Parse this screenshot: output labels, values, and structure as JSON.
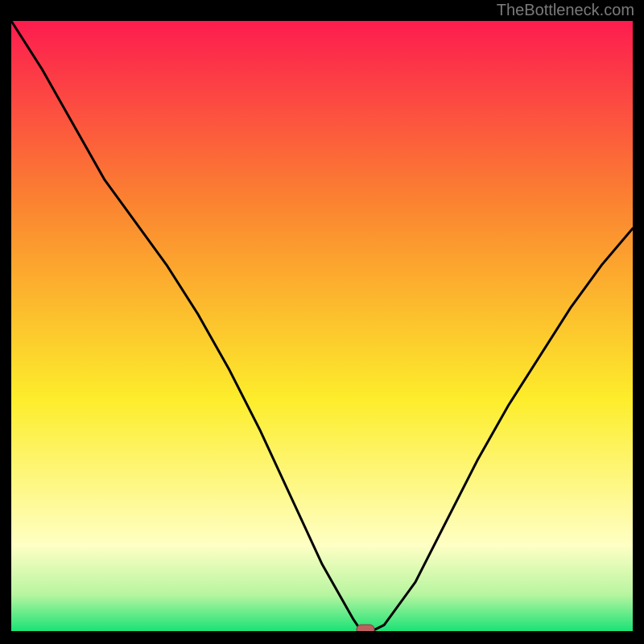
{
  "watermark": "TheBottleneck.com",
  "colors": {
    "bg": "#000000",
    "grad_top": "#fd1c4f",
    "grad_mid_upper": "#fb8430",
    "grad_mid": "#fded2b",
    "grad_low": "#feffc4",
    "grad_bottom": "#1ae276",
    "curve": "#000000",
    "marker_fill": "#bd6060",
    "marker_stroke": "#8a3f3f"
  },
  "chart_data": {
    "type": "line",
    "title": "",
    "xlabel": "",
    "ylabel": "",
    "xlim": [
      0,
      100
    ],
    "ylim": [
      0,
      100
    ],
    "x": [
      0,
      5,
      10,
      15,
      20,
      25,
      30,
      35,
      40,
      45,
      50,
      55,
      56,
      57,
      58,
      60,
      65,
      70,
      75,
      80,
      85,
      90,
      95,
      100
    ],
    "values": [
      100,
      92,
      83,
      74,
      67,
      60,
      52,
      43,
      33,
      22,
      11,
      2,
      0.5,
      0,
      0,
      1,
      8,
      18,
      28,
      37,
      45,
      53,
      60,
      66
    ],
    "marker": {
      "x": 57,
      "y": 0
    },
    "annotations": []
  }
}
